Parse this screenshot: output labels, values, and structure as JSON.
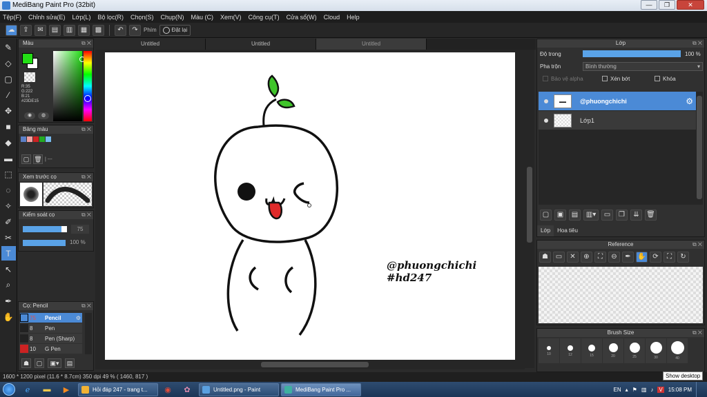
{
  "window": {
    "title": "MediBang Paint Pro (32bit)"
  },
  "menu": [
    "Tệp(F)",
    "Chỉnh sửa(E)",
    "Lớp(L)",
    "Bộ lọc(R)",
    "Chọn(S)",
    "Chụp(N)",
    "Màu (C)",
    "Xem(V)",
    "Công cụ(T)",
    "Cửa sổ(W)",
    "Cloud",
    "Help"
  ],
  "toolbar": {
    "label": "Phím",
    "reset": "Đặt lại"
  },
  "tabs": [
    "Untitled",
    "Untitled",
    "Untitled"
  ],
  "color_panel": {
    "title": "Màu",
    "rgb": [
      "R:35",
      "G:222",
      "B:21"
    ],
    "hex": "#23DE15",
    "fg": "#23de15",
    "bg": "#ffffff"
  },
  "palette_panel": {
    "title": "Bảng màu",
    "swatches": [
      "#5b7fc6",
      "#f0a0a0",
      "#cc2222",
      "#22aa22",
      "#77bbee"
    ],
    "label": "| ---"
  },
  "preview_panel": {
    "title": "Xem trước cọ"
  },
  "brush_control": {
    "title": "Kiểm soát cọ",
    "size": "75",
    "opacity": "100 %"
  },
  "brush_list": {
    "title": "Cọ: Pencil",
    "items": [
      {
        "size": "75",
        "name": "Pencil",
        "active": true
      },
      {
        "size": "8",
        "name": "Pen",
        "active": false
      },
      {
        "size": "8",
        "name": "Pen (Sharp)",
        "active": false
      },
      {
        "size": "10",
        "name": "G Pen",
        "active": false
      }
    ]
  },
  "layer_panel": {
    "title": "Lớp",
    "opacity_label": "Độ trong",
    "opacity_value": "100 %",
    "blend_label": "Pha trộn",
    "blend_value": "Bình thường",
    "protect_alpha": "Bảo vệ alpha",
    "clipping": "Xén bớt",
    "lock": "Khóa",
    "layers": [
      {
        "name": "@phuongchichi",
        "active": true
      },
      {
        "name": "Lớp1",
        "active": false
      }
    ],
    "tabs": [
      "Lớp",
      "Hoa tiêu"
    ]
  },
  "reference_panel": {
    "title": "Reference"
  },
  "brushsize_panel": {
    "title": "Brush Size",
    "sizes": [
      "10",
      "12",
      "15",
      "20",
      "25",
      "30",
      "40"
    ]
  },
  "canvas": {
    "text1": "@phuongchichi",
    "text2": "#hd247"
  },
  "status": {
    "text": "1600 * 1200 pixel  (11.6 * 8.7cm)  350 dpi  49 %  ( 1460, 817 )"
  },
  "taskbar": {
    "tasks": [
      {
        "label": "Hỏi đáp 247 - trang t...",
        "color": "#f2b233",
        "active": false
      },
      {
        "label": "Untitled.png - Paint",
        "color": "#5aa0e0",
        "active": false
      },
      {
        "label": "MediBang Paint Pro ...",
        "color": "#3fb0a0",
        "active": true
      }
    ],
    "lang": "EN",
    "time": "15:08 PM"
  },
  "tooltip": "Show desktop"
}
